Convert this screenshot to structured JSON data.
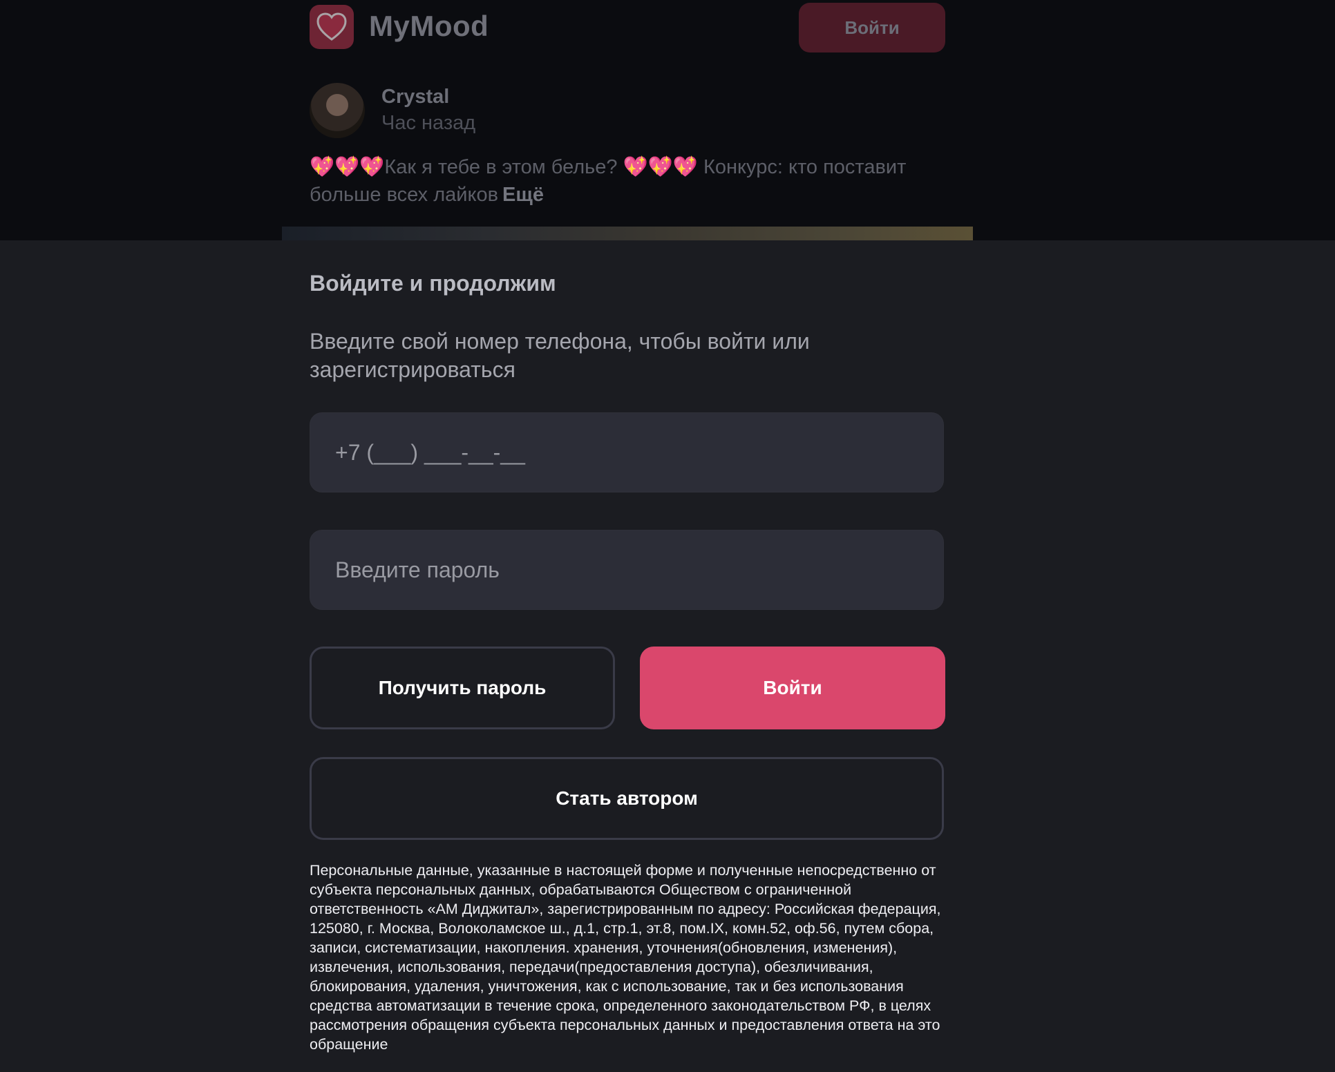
{
  "header": {
    "app_name": "MyMood",
    "login_label": "Войти"
  },
  "post": {
    "author": "Crystal",
    "time": "Час назад",
    "hearts_prefix": "💖💖💖",
    "text_part1": "Как я тебе в этом белье? ",
    "hearts_mid": "💖💖💖",
    "text_part2": " Конкурс: кто поставит больше всех лайков",
    "more_label": "Ещё"
  },
  "login_sheet": {
    "title": "Войдите и продолжим",
    "subtitle": "Введите свой номер телефона, чтобы войти или зарегистрироваться",
    "phone_placeholder": "+7 (___) ___-__-__",
    "password_placeholder": "Введите пароль",
    "get_password_label": "Получить пароль",
    "login_label": "Войти",
    "become_author_label": "Стать автором",
    "legal_text": "Персональные данные, указанные в настоящей форме и полученные непосредственно от субъекта персональных данных, обрабатываются Обществом с ограниченной ответственность «АМ Диджитал», зарегистрированным по адресу: Российская федерация, 125080, г. Москва, Волоколамское ш., д.1, стр.1, эт.8, пом.IX, комн.52, оф.56, путем сбора, записи, систематизации, накопления. хранения, уточнения(обновления, изменения), извлечения, использования, передачи(предоставления доступа), обезличивания, блокирования, удаления, уничтожения, как с использование, так и без использования средства автоматизации в течение срока, определенного законодательством РФ, в целях рассмотрения обращения субъекта персональных данных и предоставления ответа на это обращение"
  },
  "colors": {
    "accent": "#da476c",
    "sheet_bg": "#1b1c21",
    "field_bg": "#2c2d37"
  },
  "icons": {
    "logo": "heart-logo-icon"
  }
}
